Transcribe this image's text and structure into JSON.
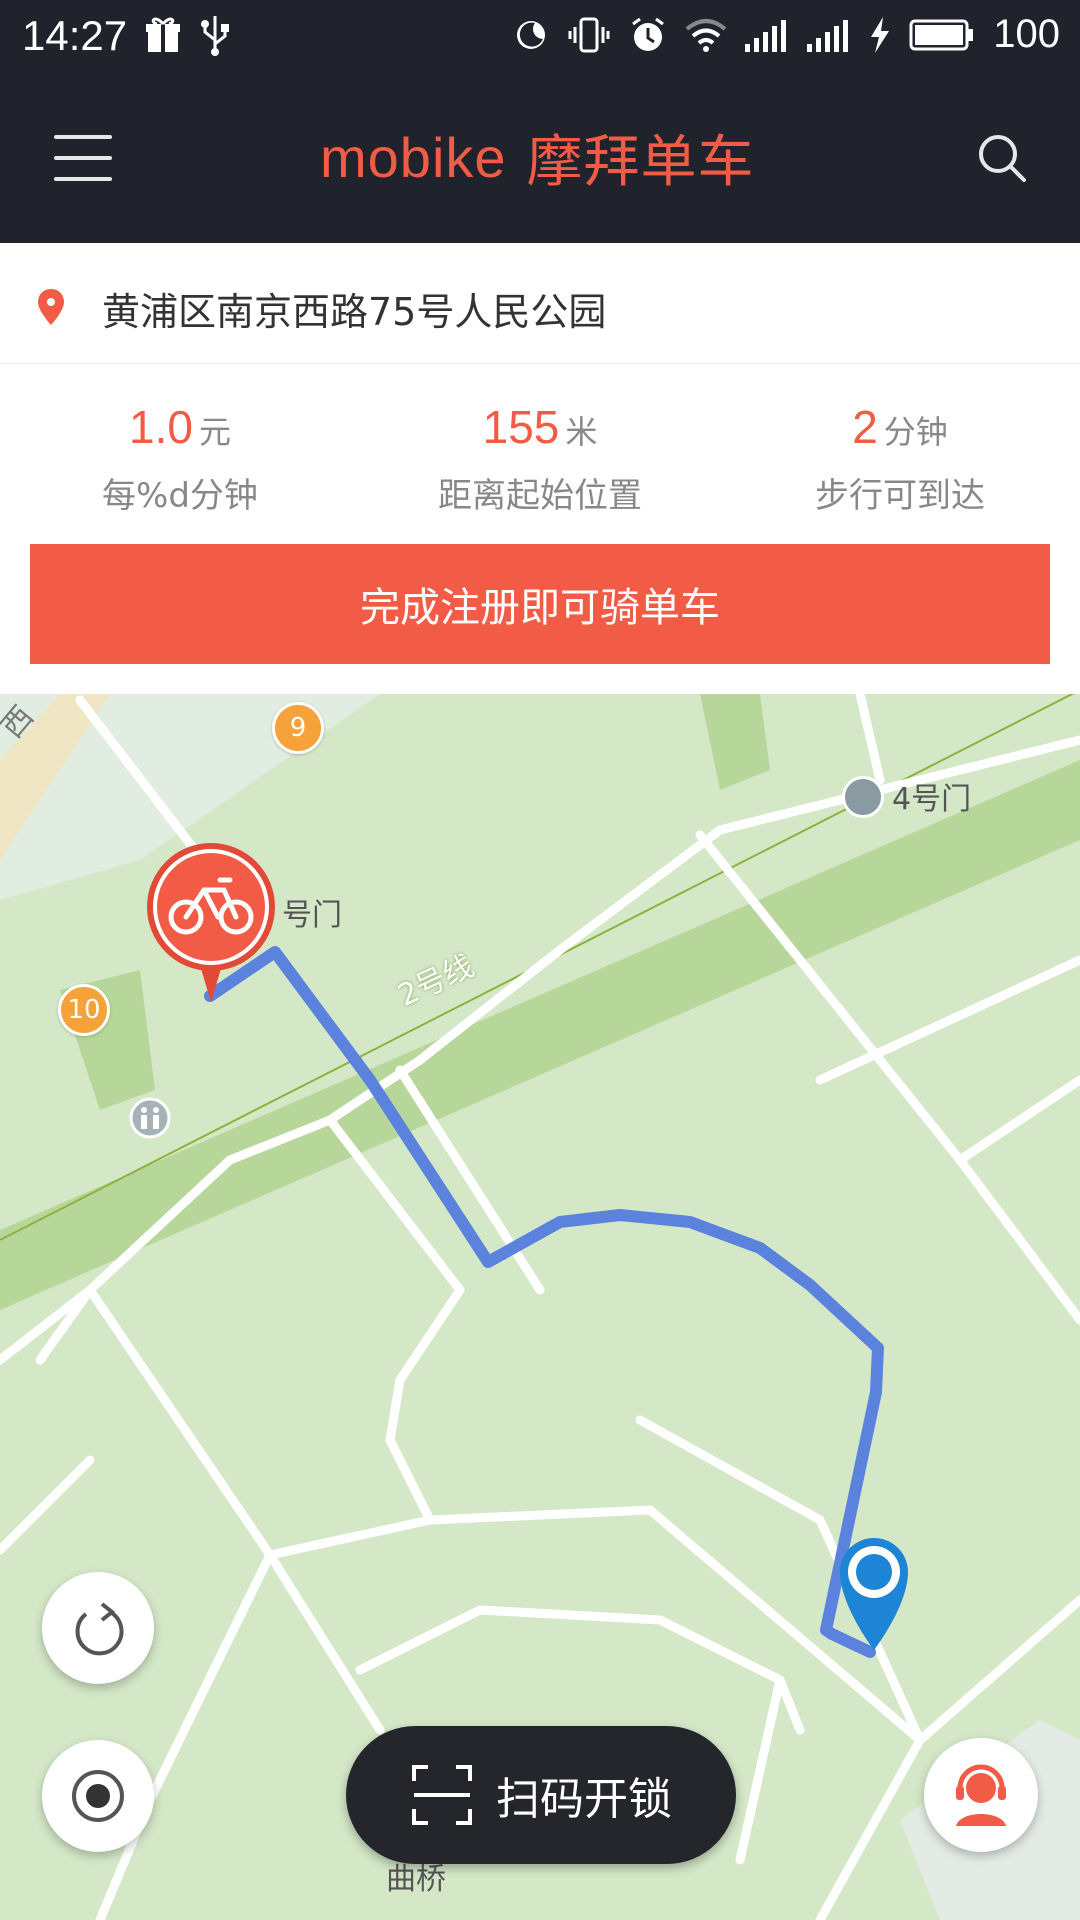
{
  "status": {
    "time": "14:27",
    "battery": "100",
    "left_icons": [
      "gift-icon",
      "usb-icon"
    ],
    "right_icons": [
      "do-not-disturb-icon",
      "vibrate-icon",
      "alarm-icon",
      "wifi-icon",
      "signal-icon",
      "signal-icon",
      "charging-icon",
      "battery-icon"
    ]
  },
  "header": {
    "brand_en": "mobike",
    "brand_cn": "摩拜单车",
    "accent": "#f25b46",
    "bg": "#20232b"
  },
  "address": {
    "text": "黄浦区南京西路75号人民公园"
  },
  "stats": [
    {
      "value": "1.0",
      "unit": "元",
      "label": "每%d分钟"
    },
    {
      "value": "155",
      "unit": "米",
      "label": "距离起始位置"
    },
    {
      "value": "2",
      "unit": "分钟",
      "label": "步行可到达"
    }
  ],
  "cta": {
    "label": "完成注册即可骑单车"
  },
  "map": {
    "labels": {
      "gate4": "4号门",
      "gate_partial": "号门",
      "line2": "2号线",
      "bottom_partial": "曲桥",
      "top_left_partial": "西"
    },
    "poi_numbers": [
      "9",
      "10"
    ]
  },
  "scan": {
    "label": "扫码开锁"
  }
}
